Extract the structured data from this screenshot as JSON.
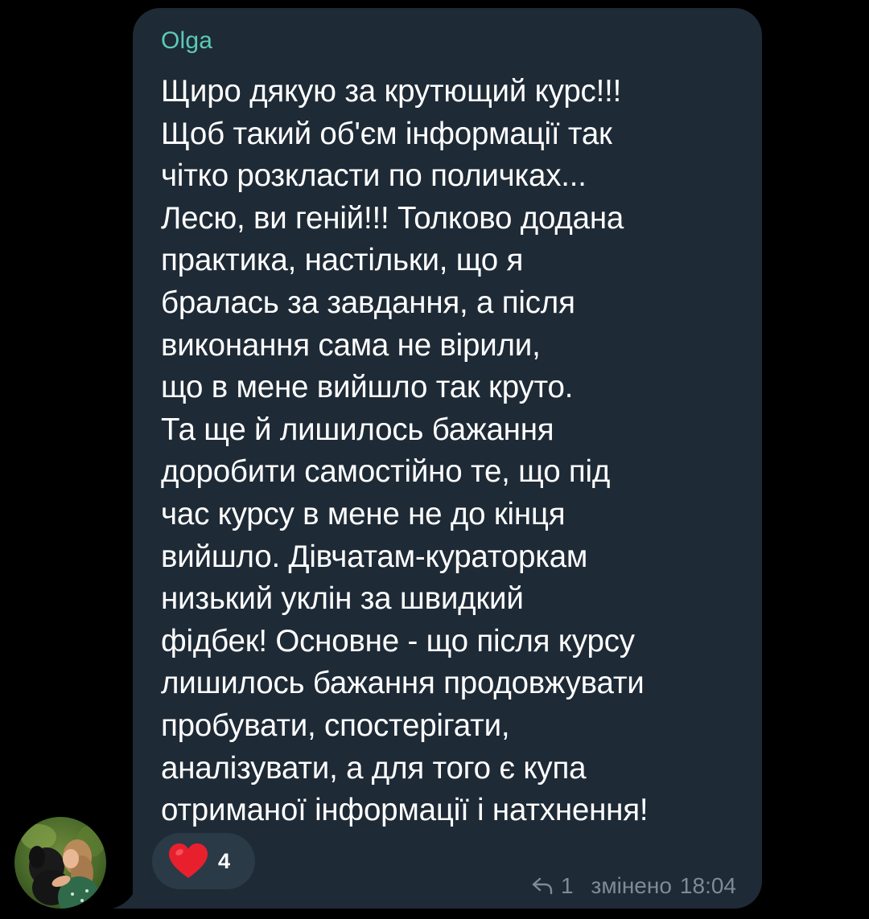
{
  "message": {
    "sender_name": "Olga",
    "text": "Щиро дякую за крутющий курс!!!\nЩоб такий об'єм інформації так\nчітко розкласти по поличках...\nЛесю, ви геній!!! Толково додана\nпрактика, настільки, що я\nбралась за завдання, а після\nвиконання сама не вірили,\nщо в мене вийшло так круто.\nТа ще й лишилось бажання\nдоробити самостійно те, що під\nчас курсу в мене не до кінця\nвийшло. Дівчатам-кураторкам\nнизький уклін за швидкий\nфідбек! Основне - що після курсу\nлишилось бажання продовжувати\nпробувати, спостерігати,\nаналізувати, а для того є купа\nотриманої інформації і натхнення!",
    "reaction": {
      "icon": "heart-icon",
      "count": "4"
    },
    "reply_icon": "reply-arrow-icon",
    "reply_count": "1",
    "edited_label": "змінено",
    "time": "18:04"
  },
  "colors": {
    "background": "#000000",
    "bubble": "#1e2a36",
    "sender_name": "#5cc9b8",
    "text": "#ffffff",
    "meta": "#7d8b99",
    "reaction_pill": "#2b3a47",
    "heart": "#e8202e"
  }
}
